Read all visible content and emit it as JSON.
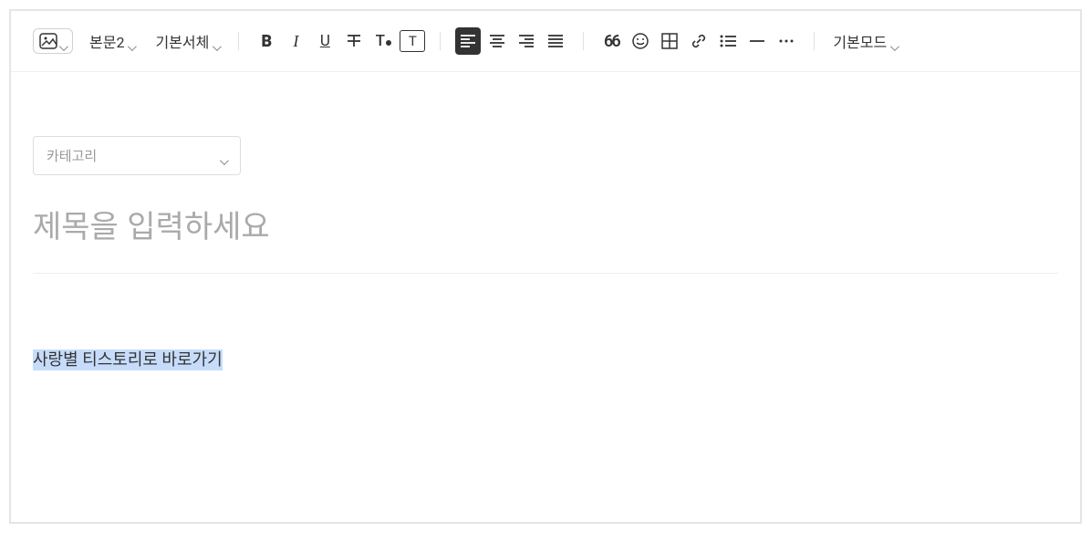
{
  "toolbar": {
    "paragraph_style": "본문2",
    "font_family": "기본서체",
    "mode": "기본모드"
  },
  "category": {
    "placeholder": "카테고리"
  },
  "title": {
    "placeholder": "제목을 입력하세요",
    "value": ""
  },
  "body": {
    "selected_text": "사랑별 티스토리로 바로가기"
  },
  "icons": {
    "image": "image-icon",
    "bold": "B",
    "italic": "I",
    "underline": "U",
    "strikethrough": "strike",
    "textcolor": "T.",
    "clearformat": "T",
    "align_left": "align-left",
    "align_center": "align-center",
    "align_right": "align-right",
    "align_justify": "align-justify",
    "quote": "66",
    "emoji": "emoji",
    "table": "table",
    "link": "link",
    "list": "list",
    "hr": "hr",
    "more": "more"
  }
}
